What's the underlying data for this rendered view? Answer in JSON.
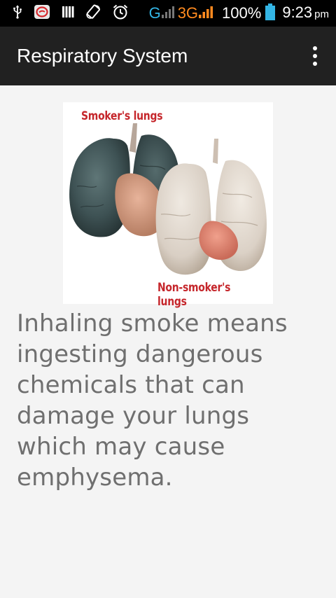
{
  "status_bar": {
    "icons_left": [
      "usb-icon",
      "messaging-icon",
      "sim-icon",
      "screen-rotate-icon",
      "alarm-icon"
    ],
    "network_g": "G",
    "network_3g": "3G",
    "battery_percent": "100%",
    "time": "9:23",
    "time_suffix": "pm",
    "colors": {
      "network_g": "#33b5e5",
      "network_3g": "#ff8a1f",
      "battery": "#33b5e5"
    }
  },
  "app_bar": {
    "title": "Respiratory System",
    "menu_icon": "overflow-menu-icon"
  },
  "content": {
    "image": {
      "label_top": "Smoker's lungs",
      "label_bottom": "Non-smoker's lungs"
    },
    "body_text": "Inhaling smoke means ingesting dangerous chemicals that can damage your lungs which may cause emphysema."
  }
}
